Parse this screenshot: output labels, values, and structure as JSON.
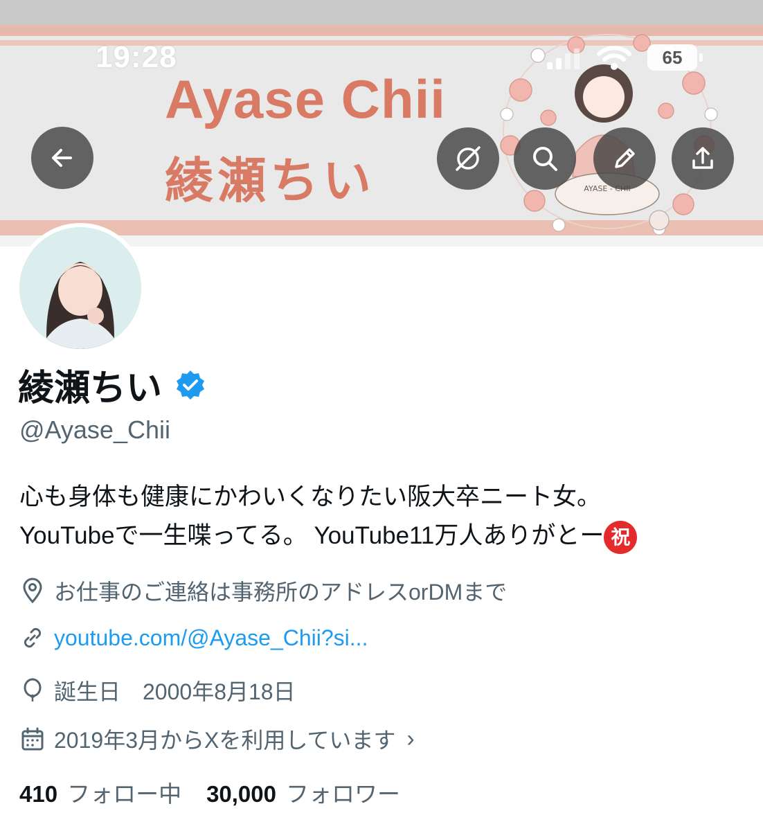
{
  "status_bar": {
    "time": "19:28",
    "battery": "65"
  },
  "banner": {
    "title_en": "Ayase Chii",
    "title_jp": "綾瀬ちい",
    "colors": {
      "accent_text": "#d97a64",
      "stripe": "#e7b9ad"
    }
  },
  "header_buttons": {
    "back": "arrow-left-icon",
    "grok": "slash-circle-icon",
    "search": "search-icon",
    "edit": "pencil-icon",
    "share": "share-icon"
  },
  "profile": {
    "display_name": "綾瀬ちい",
    "verified": true,
    "handle": "@Ayase_Chii",
    "bio_line1": "心も身体も健康にかわいくなりたい阪大卒ニート女。",
    "bio_line2": "YouTubeで一生喋ってる。 YouTube11万人ありがとー",
    "bio_emoji": "祝",
    "location": "お仕事のご連絡は事務所のアドレスorDMまで",
    "website": "youtube.com/@Ayase_Chii?si...",
    "birthday": "誕生日　2000年8月18日",
    "joined": "2019年3月からXを利用しています",
    "following_count": "410",
    "following_label": "フォロー中",
    "followers_count": "30,000",
    "followers_label": "フォロワー"
  },
  "colors": {
    "text_primary": "#0f1419",
    "text_secondary": "#536471",
    "link": "#1d9bf0",
    "verified_badge": "#1d9bf0"
  }
}
